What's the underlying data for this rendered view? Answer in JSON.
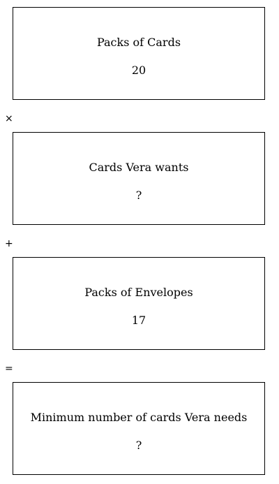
{
  "boxes": [
    {
      "label": "Packs of Cards",
      "value": "20"
    },
    {
      "label": "Cards Vera wants",
      "value": "?"
    },
    {
      "label": "Packs of Envelopes",
      "value": "17"
    },
    {
      "label": "Minimum number of cards Vera needs",
      "value": "?"
    }
  ],
  "operators": [
    "×",
    "+",
    "="
  ]
}
